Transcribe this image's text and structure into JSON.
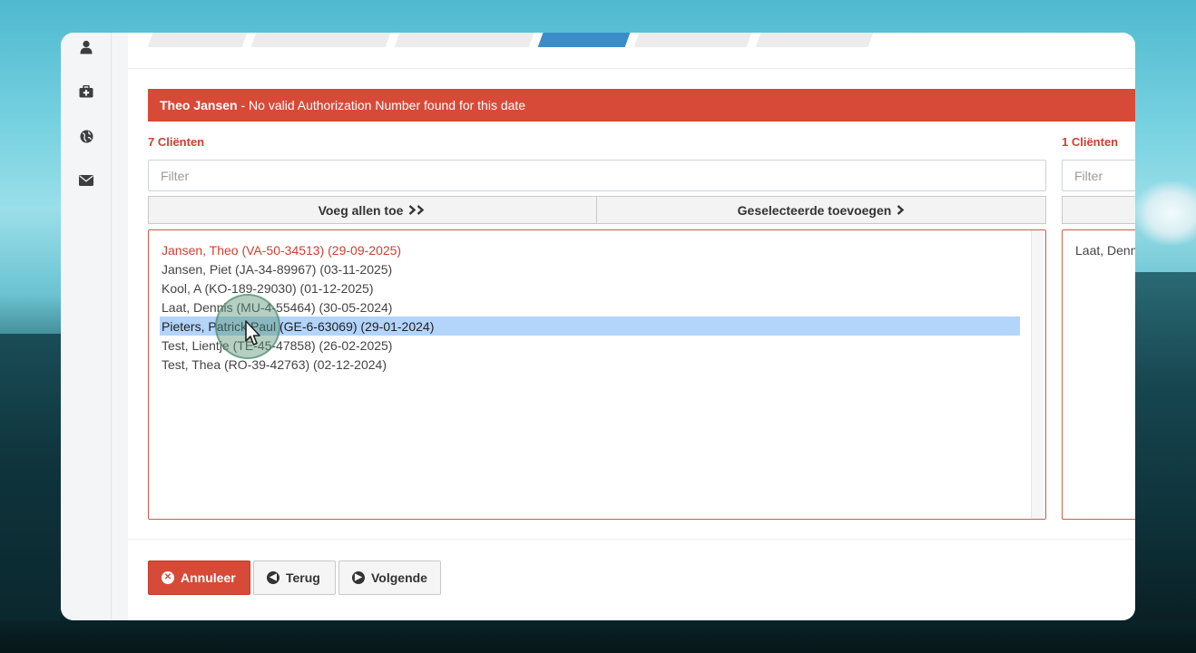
{
  "alert": {
    "name": "Theo Jansen",
    "message": " - No valid Authorization Number found for this date"
  },
  "left_panel": {
    "count_label": "7 Cliënten",
    "filter_placeholder": "Filter",
    "add_all_label": "Voeg allen toe",
    "add_selected_label": "Geselecteerde toevoegen",
    "clients": [
      {
        "label": "Jansen, Theo (VA-50-34513) (29-09-2025)",
        "status": "invalid"
      },
      {
        "label": "Jansen, Piet (JA-34-89967) (03-11-2025)",
        "status": "normal"
      },
      {
        "label": "Kool, A (KO-189-29030) (01-12-2025)",
        "status": "normal"
      },
      {
        "label": "Laat, Dennis (MU-4-55464) (30-05-2024)",
        "status": "normal"
      },
      {
        "label": "Pieters, Patrick Paul (GE-6-63069) (29-01-2024)",
        "status": "selected"
      },
      {
        "label": "Test, Lientje (TE-45-47858) (26-02-2025)",
        "status": "normal"
      },
      {
        "label": "Test, Thea (RO-39-42763) (02-12-2024)",
        "status": "normal"
      }
    ]
  },
  "right_panel": {
    "count_label": "1 Cliënten",
    "filter_placeholder": "Filter",
    "clients": [
      "Laat, Denn"
    ]
  },
  "footer": {
    "cancel_label": "Annuleer",
    "back_label": "Terug",
    "next_label": "Volgende"
  },
  "colors": {
    "danger": "#d84a38",
    "active_tab": "#3b8dc9",
    "selection": "#b3d4fb"
  }
}
